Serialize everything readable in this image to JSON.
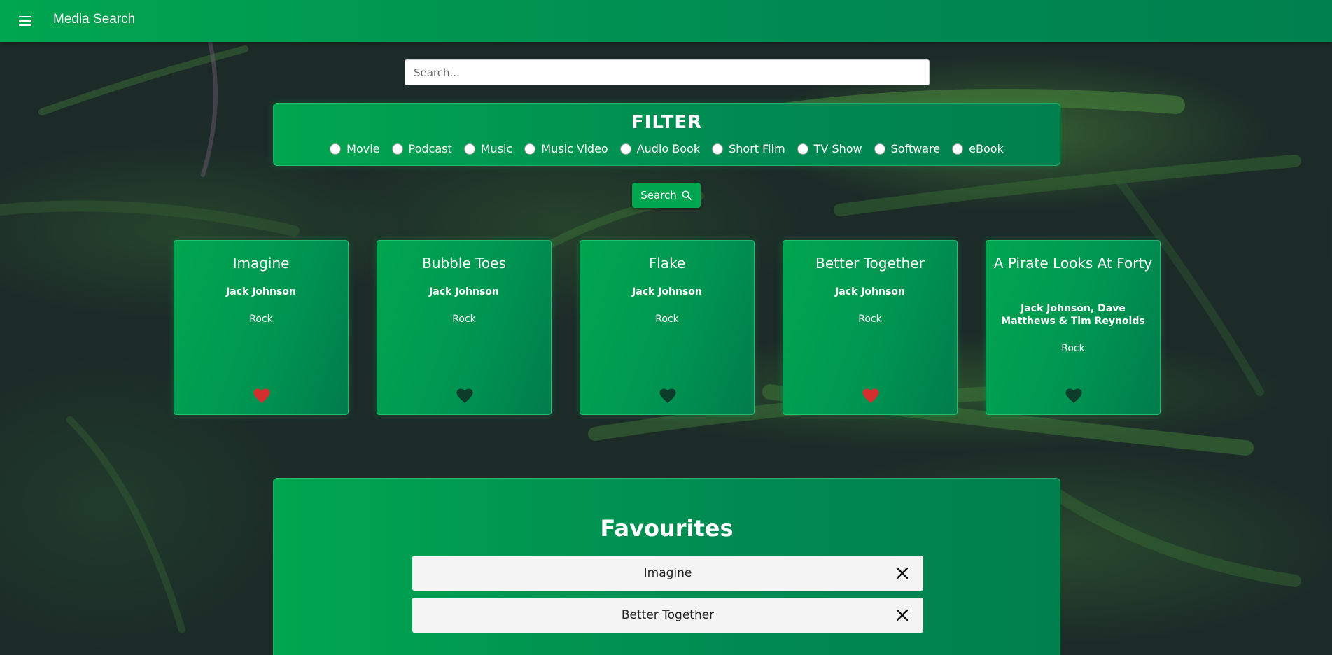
{
  "app": {
    "title": "Media Search"
  },
  "search": {
    "placeholder": "Search...",
    "value": ""
  },
  "filter": {
    "title": "FILTER",
    "options": [
      "Movie",
      "Podcast",
      "Music",
      "Music Video",
      "Audio Book",
      "Short Film",
      "TV Show",
      "Software",
      "eBook"
    ]
  },
  "search_button": {
    "label": "Search"
  },
  "results": [
    {
      "title": "Imagine",
      "artist": "Jack Johnson",
      "genre": "Rock",
      "favourite": true
    },
    {
      "title": "Bubble Toes",
      "artist": "Jack Johnson",
      "genre": "Rock",
      "favourite": false
    },
    {
      "title": "Flake",
      "artist": "Jack Johnson",
      "genre": "Rock",
      "favourite": false
    },
    {
      "title": "Better Together",
      "artist": "Jack Johnson",
      "genre": "Rock",
      "favourite": true
    },
    {
      "title": "A Pirate Looks At Forty",
      "artist": "Jack Johnson, Dave Matthews & Tim Reynolds",
      "genre": "Rock",
      "favourite": false
    }
  ],
  "favourites": {
    "title": "Favourites",
    "items": [
      "Imagine",
      "Better Together"
    ]
  },
  "colors": {
    "accent": "#00a650",
    "heart_favourite": "#d32f2f",
    "heart_default": "#0b3d2a"
  },
  "icons": {
    "menu": "menu-icon",
    "search": "search-icon",
    "heart": "heart-icon",
    "close": "close-icon"
  }
}
